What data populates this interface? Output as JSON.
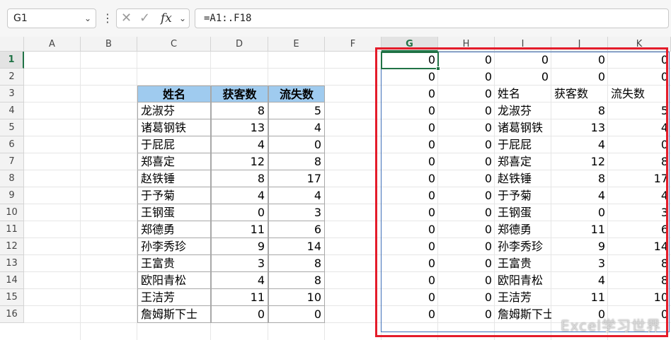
{
  "namebox": {
    "value": "G1"
  },
  "formula_bar": {
    "text": "=A1:.F18"
  },
  "columns": [
    "A",
    "B",
    "C",
    "D",
    "E",
    "F",
    "G",
    "H",
    "I",
    "J",
    "K"
  ],
  "rows": [
    "1",
    "2",
    "3",
    "4",
    "5",
    "6",
    "7",
    "8",
    "9",
    "10",
    "11",
    "12",
    "13",
    "14",
    "15",
    "16"
  ],
  "table": {
    "headers": [
      "姓名",
      "获客数",
      "流失数"
    ],
    "rows": [
      [
        "龙淑芬",
        "8",
        "5"
      ],
      [
        "诸葛钢铁",
        "13",
        "4"
      ],
      [
        "于屁屁",
        "4",
        "0"
      ],
      [
        "郑喜定",
        "12",
        "8"
      ],
      [
        "赵铁锤",
        "8",
        "17"
      ],
      [
        "于予菊",
        "4",
        "4"
      ],
      [
        "王钢蛋",
        "0",
        "3"
      ],
      [
        "郑德勇",
        "11",
        "6"
      ],
      [
        "孙李秀珍",
        "9",
        "14"
      ],
      [
        "王富贵",
        "3",
        "8"
      ],
      [
        "欧阳青松",
        "4",
        "8"
      ],
      [
        "王洁芳",
        "11",
        "10"
      ],
      [
        "詹姆斯下士",
        "0",
        "0"
      ]
    ]
  },
  "zero": "0",
  "watermark": "Excel学习世界",
  "colors": {
    "table_header": "#9fcbef",
    "highlight_box": "#e41c2a",
    "active_cell": "#217346"
  }
}
